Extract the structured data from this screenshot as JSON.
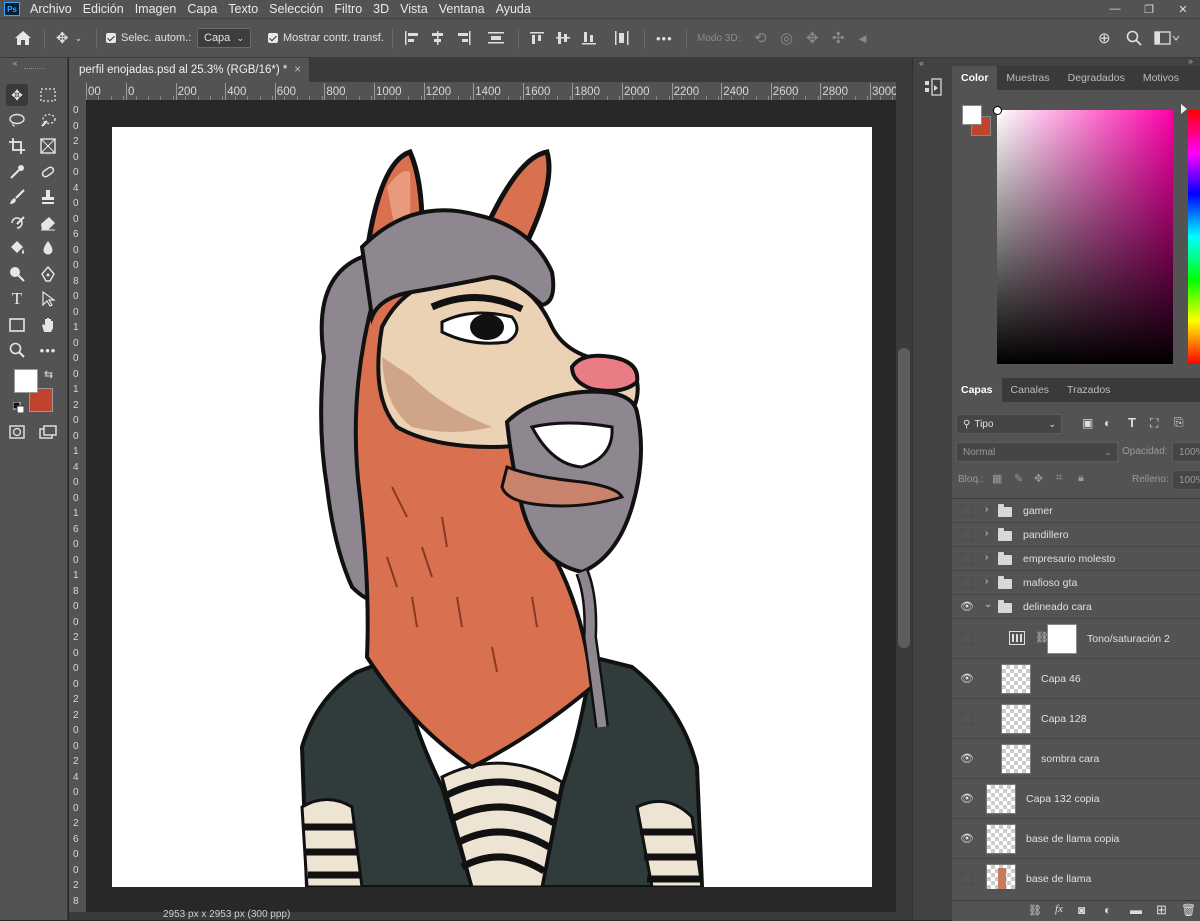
{
  "app": {
    "logo_text": "Ps"
  },
  "menu": [
    "Archivo",
    "Edición",
    "Imagen",
    "Capa",
    "Texto",
    "Selección",
    "Filtro",
    "3D",
    "Vista",
    "Ventana",
    "Ayuda"
  ],
  "options_bar": {
    "auto_select_label": "Selec. autom.:",
    "auto_select_value": "Capa",
    "show_transform_label": "Mostrar contr. transf.",
    "mode3d_label": "Modo 3D:",
    "more_label": "•••"
  },
  "document": {
    "tab_title": "perfil enojadas.psd al 25.3% (RGB/16*) *",
    "close_glyph": "×",
    "status_text": "2953 px x 2953 px (300 ppp)"
  },
  "ruler": {
    "h_ticks": [
      "00",
      "0",
      "200",
      "400",
      "600",
      "800",
      "1000",
      "1200",
      "1400",
      "1600",
      "1800",
      "2000",
      "2200",
      "2400",
      "2600",
      "2800",
      "3000"
    ],
    "v_labels": [
      "0",
      "0",
      "2",
      "0",
      "0",
      "4",
      "0",
      "0",
      "6",
      "0",
      "0",
      "8",
      "0",
      "0",
      "1",
      "0",
      "0",
      "0",
      "1",
      "2",
      "0",
      "0",
      "1",
      "4",
      "0",
      "0",
      "1",
      "6",
      "0",
      "0",
      "1",
      "8",
      "0",
      "0",
      "2",
      "0",
      "0",
      "0",
      "2",
      "2",
      "0",
      "0",
      "2",
      "4",
      "0",
      "0",
      "2",
      "6",
      "0",
      "0",
      "2",
      "8"
    ]
  },
  "color_panel": {
    "tabs": [
      "Color",
      "Muestras",
      "Degradados",
      "Motivos"
    ],
    "active_tab": "Color",
    "foreground": "#ffffff",
    "background": "#c0432e"
  },
  "layers_panel": {
    "tabs": [
      "Capas",
      "Canales",
      "Trazados"
    ],
    "active_tab": "Capas",
    "filter_label": "Tipo",
    "blend_mode": "Normal",
    "opacity_label": "Opacidad:",
    "opacity_value": "100%",
    "lock_label": "Bloq.:",
    "fill_label": "Relleno:",
    "fill_value": "100%",
    "layers": [
      {
        "name": "gamer",
        "kind": "group",
        "visible": false
      },
      {
        "name": "pandillero",
        "kind": "group",
        "visible": false
      },
      {
        "name": "empresario molesto",
        "kind": "group",
        "visible": false
      },
      {
        "name": "mafioso gta",
        "kind": "group",
        "visible": false
      },
      {
        "name": "delineado cara",
        "kind": "group-open",
        "visible": true
      },
      {
        "name": "Tono/saturación 2",
        "kind": "adjustment",
        "visible": false
      },
      {
        "name": "Capa 46",
        "kind": "layer",
        "visible": true
      },
      {
        "name": "Capa 128",
        "kind": "layer",
        "visible": false
      },
      {
        "name": "sombra cara",
        "kind": "layer",
        "visible": true
      },
      {
        "name": "Capa 132 copia",
        "kind": "layer",
        "visible": true
      },
      {
        "name": "base de llama copia",
        "kind": "layer",
        "visible": true
      },
      {
        "name": "base de llama",
        "kind": "layer",
        "visible": false
      }
    ],
    "footer_icons": [
      "link-icon",
      "fx-icon",
      "mask-icon",
      "adjustment-icon",
      "group-icon",
      "new-layer-icon",
      "trash-icon"
    ]
  }
}
